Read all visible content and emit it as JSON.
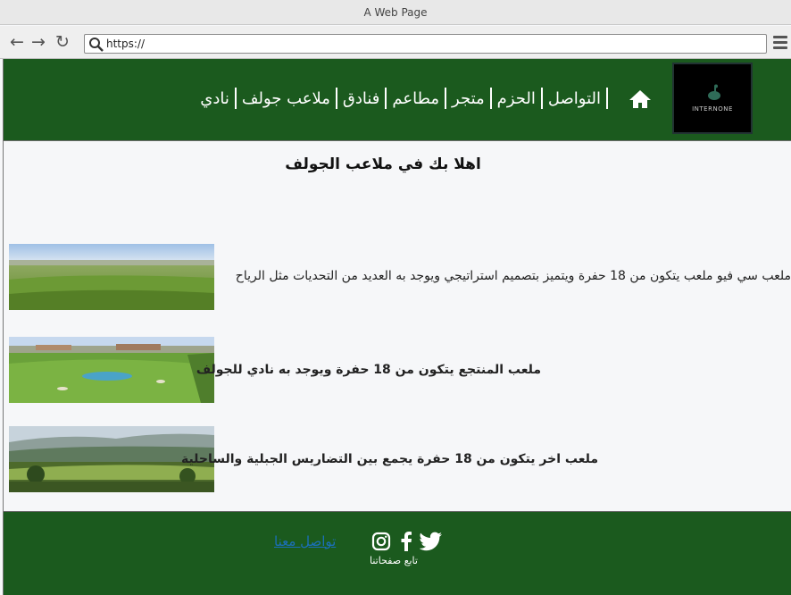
{
  "browser": {
    "title": "A Web Page",
    "url": "https://"
  },
  "header": {
    "logo_text": "INTERNONE",
    "nav": [
      "التواصل",
      "الحزم",
      "متجر",
      "مطاعم",
      "فنادق",
      "ملاعب جولف",
      "نادي"
    ]
  },
  "main": {
    "welcome": "اهلا بك في ملاعب الجولف",
    "courses": [
      {
        "text": "ملعب سي فيو  ملعب يتكون من 18 حفرة ويتميز بتصميم استراتيجي ويوجد به العديد من التحديات مثل الرياح"
      },
      {
        "text": "ملعب  المنتجع يتكون من 18 حفرة ويوجد به نادي للجولف"
      },
      {
        "text": "ملعب اخر يتكون من 18 حفرة يجمع بين التضاريس الجبلية والساحلية"
      }
    ]
  },
  "footer": {
    "contact_link": "تواصل معنا",
    "follow_label": "تابع صفحاتنا",
    "social": [
      "twitter-icon",
      "facebook-icon",
      "instagram-icon"
    ]
  },
  "colors": {
    "header_green": "#1b5a1e",
    "link_blue": "#1b6fb8",
    "page_bg": "#f6f7f9"
  }
}
